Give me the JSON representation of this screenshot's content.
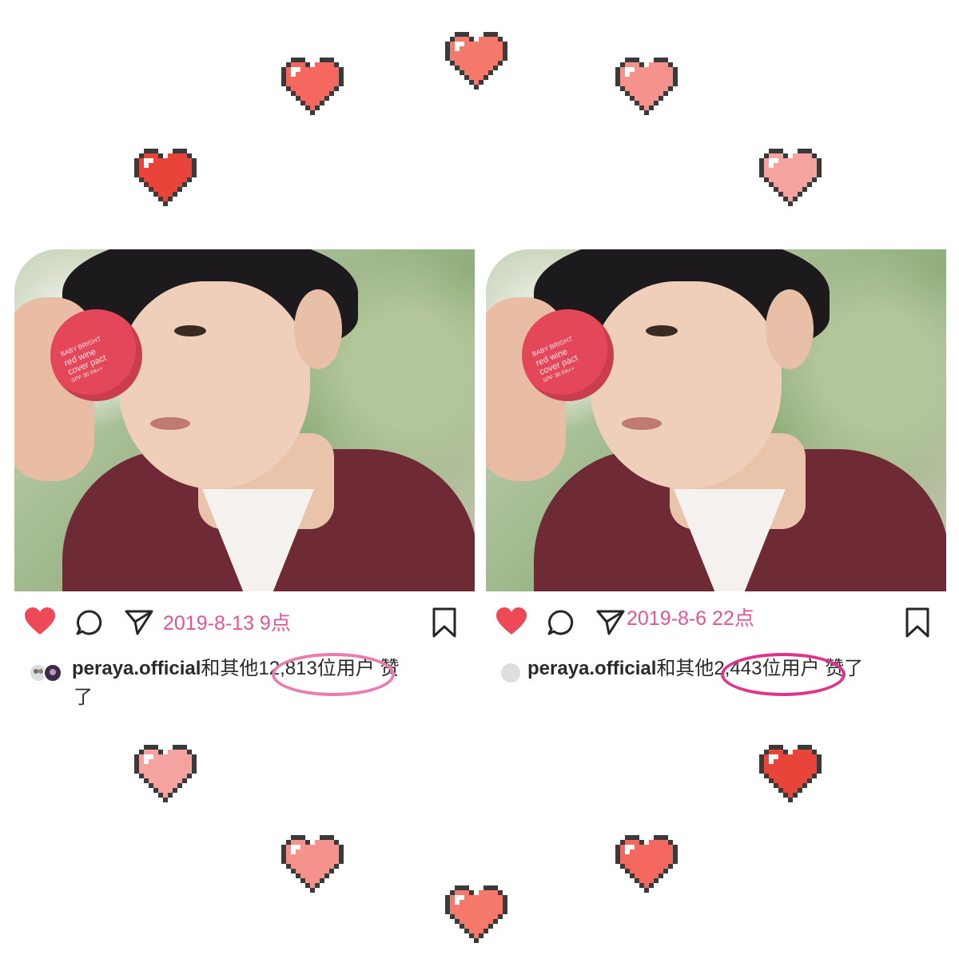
{
  "colors": {
    "heart_red": "#e8443a",
    "heart_salmon": "#f4796b",
    "heart_pink": "#f4a3a0",
    "date_pink": "#e0559a",
    "highlight_left": "#ec7bb0",
    "highlight_right": "#e0348a"
  },
  "icons": {
    "like": "heart-icon",
    "comment": "comment-icon",
    "share": "send-icon",
    "save": "bookmark-icon"
  },
  "photo_text": {
    "brand": "BABY BRIGHT",
    "product_line1": "red wine",
    "product_line2": "cover pact",
    "spf": "SPF 30 PA++"
  },
  "posts": [
    {
      "date_label": "2019-8-13 9点",
      "username": "peraya.official",
      "likes_prefix": "和其",
      "likes_count": "他12,813位",
      "likes_suffix": "用户 赞",
      "likes_wrap": "了"
    },
    {
      "date_label": "2019-8-6 22点",
      "username": "peraya.official",
      "likes_prefix": "和其",
      "likes_count": "他2,443位",
      "likes_suffix": "用户 赞了",
      "likes_wrap": ""
    }
  ]
}
